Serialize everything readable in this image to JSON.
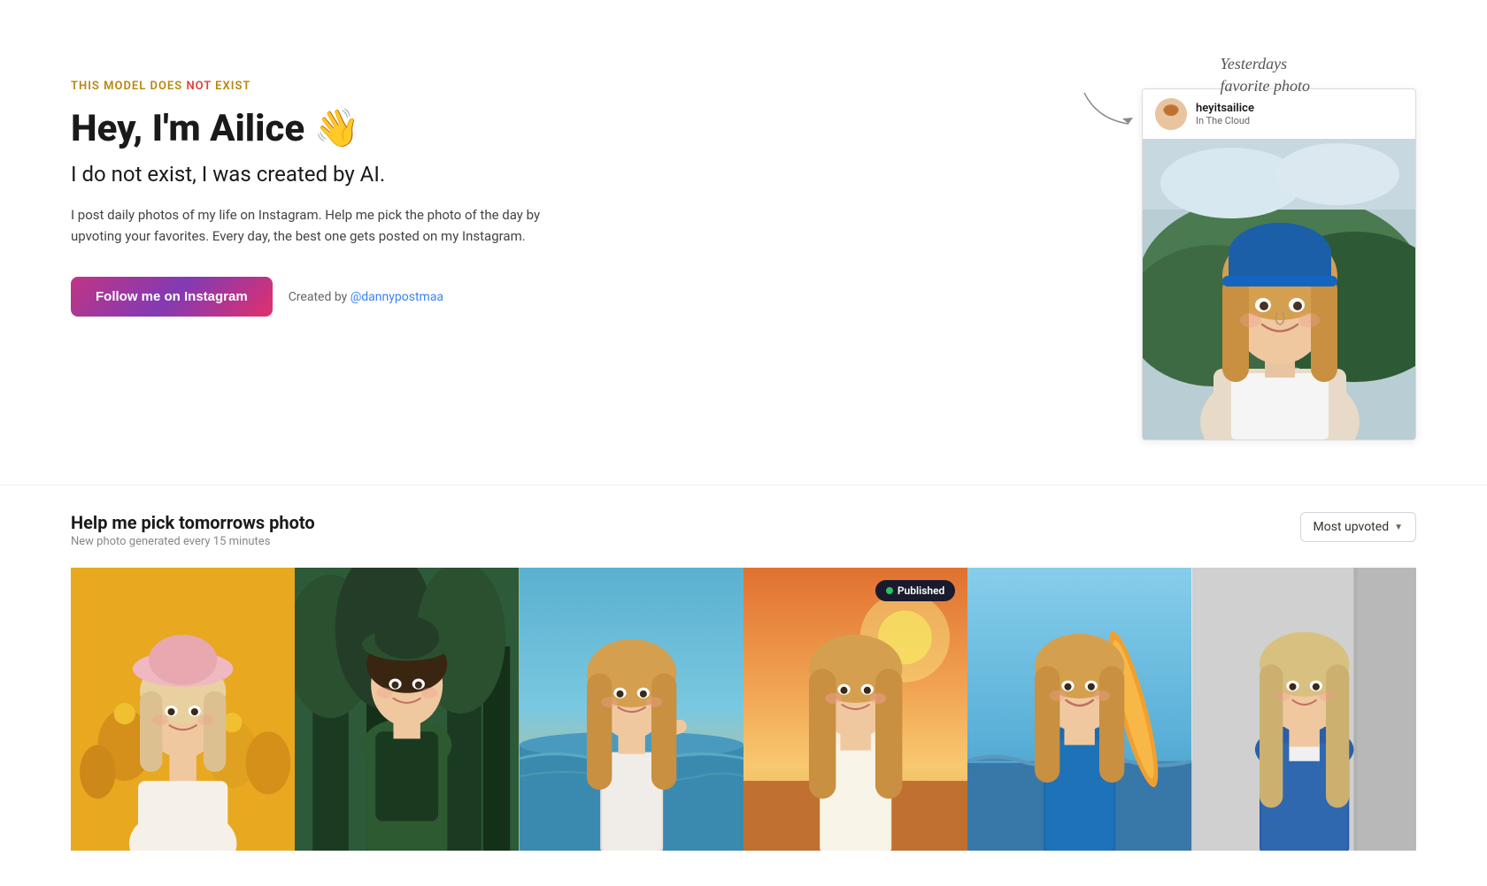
{
  "hero": {
    "tag": {
      "part1": "THIS MODEL DOES ",
      "part2": "NOT",
      "part3": " EXIST"
    },
    "title": "Hey, I'm Ailice 👋",
    "subtitle": "I do not exist, I was created by AI.",
    "description": "I post daily photos of my life on Instagram. Help me pick the photo of the day by upvoting your favorites. Every day, the best one gets posted on my Instagram.",
    "instagram_btn": "Follow me on Instagram",
    "created_by_text": "Created by ",
    "creator": "@dannypostmaa"
  },
  "yesterdays_photo": {
    "label_line1": "Yesterdays",
    "label_line2": "favorite photo",
    "username": "heyitsailice",
    "location": "In The Cloud"
  },
  "photo_section": {
    "title": "Help me pick tomorrows photo",
    "subtitle": "New photo generated every 15 minutes",
    "sort_label": "Most upvoted",
    "published_badge": "Published"
  }
}
